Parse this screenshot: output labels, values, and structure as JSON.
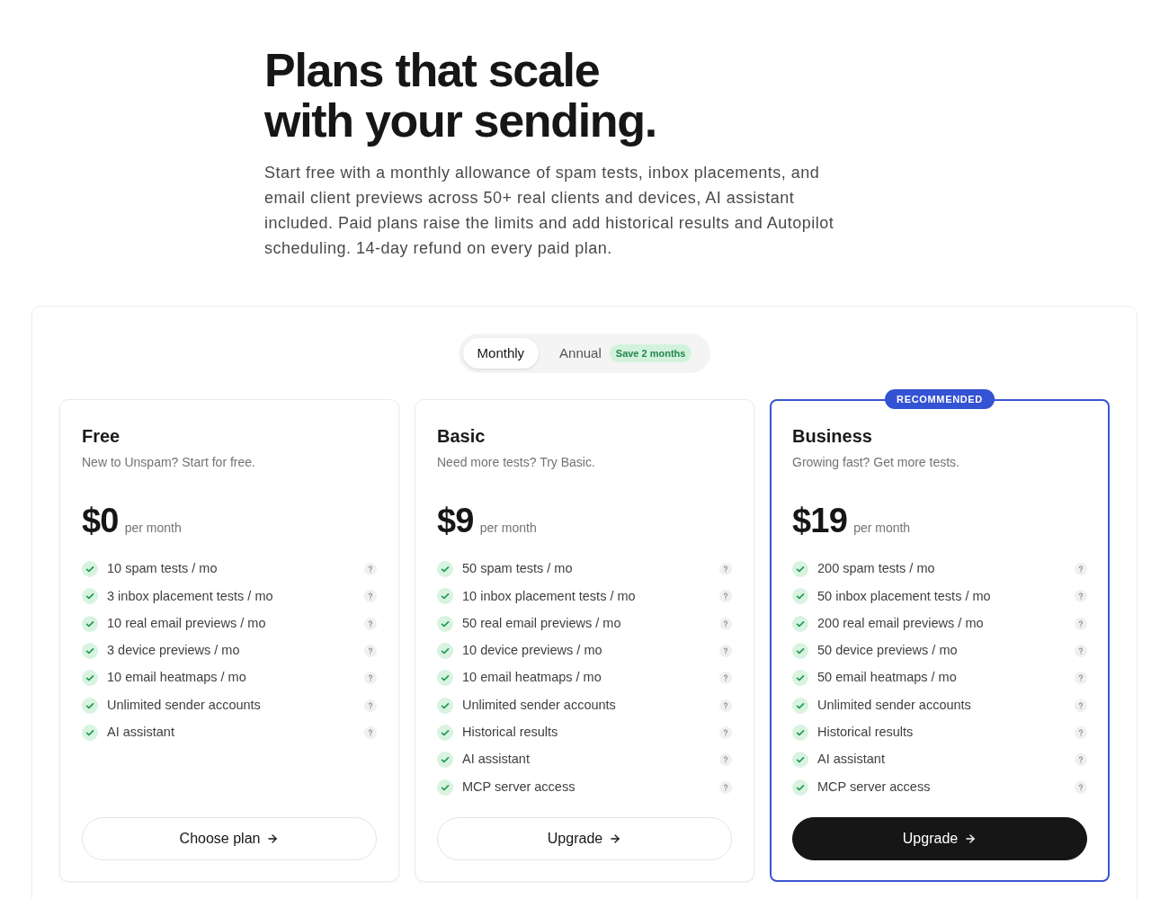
{
  "hero": {
    "title_lines": [
      "Plans that scale",
      "with your sending."
    ],
    "description": "Start free with a monthly allowance of spam tests, inbox placements, and email client previews across 50+ real clients and devices, AI assistant included. Paid plans raise the limits and add historical results and Autopilot scheduling. 14-day refund on every paid plan."
  },
  "billing_toggle": {
    "options": [
      {
        "label": "Monthly",
        "selected": true
      },
      {
        "label": "Annual",
        "selected": false,
        "badge": "Save 2 months"
      }
    ]
  },
  "plans": [
    {
      "name": "Free",
      "tagline": "New to Unspam? Start for free.",
      "price": "$0",
      "period": "per month",
      "highlighted": false,
      "features": [
        "10 spam tests / mo",
        "3 inbox placement tests / mo",
        "10 real email previews / mo",
        "3 device previews / mo",
        "10 email heatmaps / mo",
        "Unlimited sender accounts",
        "AI assistant"
      ],
      "button": {
        "label": "Choose plan",
        "kind": "outline"
      }
    },
    {
      "name": "Basic",
      "tagline": "Need more tests? Try Basic.",
      "price": "$9",
      "period": "per month",
      "highlighted": false,
      "features": [
        "50 spam tests / mo",
        "10 inbox placement tests / mo",
        "50 real email previews / mo",
        "10 device previews / mo",
        "10 email heatmaps / mo",
        "Unlimited sender accounts",
        "Historical results",
        "AI assistant",
        "MCP server access"
      ],
      "button": {
        "label": "Upgrade",
        "kind": "outline"
      }
    },
    {
      "name": "Business",
      "tagline": "Growing fast? Get more tests.",
      "price": "$19",
      "period": "per month",
      "highlighted": true,
      "badge": "RECOMMENDED",
      "features": [
        "200 spam tests / mo",
        "50 inbox placement tests / mo",
        "200 real email previews / mo",
        "50 device previews / mo",
        "50 email heatmaps / mo",
        "Unlimited sender accounts",
        "Historical results",
        "AI assistant",
        "MCP server access"
      ],
      "button": {
        "label": "Upgrade",
        "kind": "solid"
      }
    }
  ]
}
